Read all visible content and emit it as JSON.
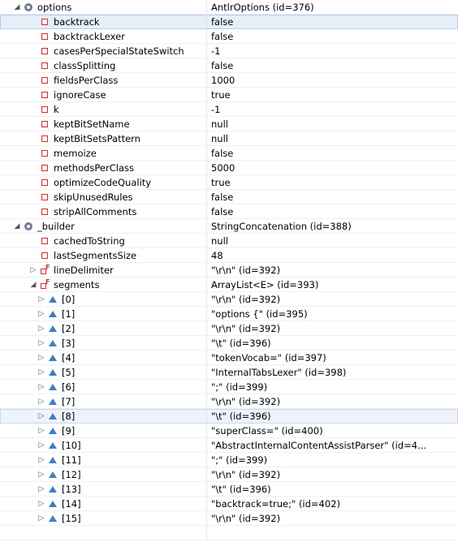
{
  "rows": [
    {
      "depth": 0,
      "exp": "open",
      "icon": "circle",
      "name": "options",
      "value": "AntlrOptions  (id=376)"
    },
    {
      "depth": 1,
      "exp": "none",
      "icon": "square",
      "name": "backtrack",
      "value": "false",
      "sel": 1
    },
    {
      "depth": 1,
      "exp": "none",
      "icon": "square",
      "name": "backtrackLexer",
      "value": "false"
    },
    {
      "depth": 1,
      "exp": "none",
      "icon": "square",
      "name": "casesPerSpecialStateSwitch",
      "value": "-1"
    },
    {
      "depth": 1,
      "exp": "none",
      "icon": "square",
      "name": "classSplitting",
      "value": "false"
    },
    {
      "depth": 1,
      "exp": "none",
      "icon": "square",
      "name": "fieldsPerClass",
      "value": "1000"
    },
    {
      "depth": 1,
      "exp": "none",
      "icon": "square",
      "name": "ignoreCase",
      "value": "true"
    },
    {
      "depth": 1,
      "exp": "none",
      "icon": "square",
      "name": "k",
      "value": "-1"
    },
    {
      "depth": 1,
      "exp": "none",
      "icon": "square",
      "name": "keptBitSetName",
      "value": "null"
    },
    {
      "depth": 1,
      "exp": "none",
      "icon": "square",
      "name": "keptBitSetsPattern",
      "value": "null"
    },
    {
      "depth": 1,
      "exp": "none",
      "icon": "square",
      "name": "memoize",
      "value": "false"
    },
    {
      "depth": 1,
      "exp": "none",
      "icon": "square",
      "name": "methodsPerClass",
      "value": "5000"
    },
    {
      "depth": 1,
      "exp": "none",
      "icon": "square",
      "name": "optimizeCodeQuality",
      "value": "true"
    },
    {
      "depth": 1,
      "exp": "none",
      "icon": "square",
      "name": "skipUnusedRules",
      "value": "false"
    },
    {
      "depth": 1,
      "exp": "none",
      "icon": "square",
      "name": "stripAllComments",
      "value": "false"
    },
    {
      "depth": 0,
      "exp": "open",
      "icon": "circle",
      "name": "_builder",
      "value": "StringConcatenation  (id=388)"
    },
    {
      "depth": 1,
      "exp": "none",
      "icon": "square",
      "name": "cachedToString",
      "value": "null"
    },
    {
      "depth": 1,
      "exp": "none",
      "icon": "square",
      "name": "lastSegmentsSize",
      "value": "48"
    },
    {
      "depth": 1,
      "exp": "closed",
      "icon": "final",
      "name": "lineDelimiter",
      "value": "\"\\r\\n\" (id=392)"
    },
    {
      "depth": 1,
      "exp": "open",
      "icon": "final",
      "name": "segments",
      "value": "ArrayList<E>  (id=393)"
    },
    {
      "depth": 2,
      "exp": "closed",
      "icon": "triangle",
      "name": "[0]",
      "value": "\"\\r\\n\" (id=392)"
    },
    {
      "depth": 2,
      "exp": "closed",
      "icon": "triangle",
      "name": "[1]",
      "value": "\"options {\" (id=395)"
    },
    {
      "depth": 2,
      "exp": "closed",
      "icon": "triangle",
      "name": "[2]",
      "value": "\"\\r\\n\" (id=392)"
    },
    {
      "depth": 2,
      "exp": "closed",
      "icon": "triangle",
      "name": "[3]",
      "value": "\"\\t\" (id=396)"
    },
    {
      "depth": 2,
      "exp": "closed",
      "icon": "triangle",
      "name": "[4]",
      "value": "\"tokenVocab=\" (id=397)"
    },
    {
      "depth": 2,
      "exp": "closed",
      "icon": "triangle",
      "name": "[5]",
      "value": "\"InternalTabsLexer\" (id=398)"
    },
    {
      "depth": 2,
      "exp": "closed",
      "icon": "triangle",
      "name": "[6]",
      "value": "\";\" (id=399)"
    },
    {
      "depth": 2,
      "exp": "closed",
      "icon": "triangle",
      "name": "[7]",
      "value": "\"\\r\\n\" (id=392)"
    },
    {
      "depth": 2,
      "exp": "closed",
      "icon": "triangle",
      "name": "[8]",
      "value": "\"\\t\" (id=396)",
      "sel": 2
    },
    {
      "depth": 2,
      "exp": "closed",
      "icon": "triangle",
      "name": "[9]",
      "value": "\"superClass=\" (id=400)"
    },
    {
      "depth": 2,
      "exp": "closed",
      "icon": "triangle",
      "name": "[10]",
      "value": "\"AbstractInternalContentAssistParser\" (id=4..."
    },
    {
      "depth": 2,
      "exp": "closed",
      "icon": "triangle",
      "name": "[11]",
      "value": "\";\" (id=399)"
    },
    {
      "depth": 2,
      "exp": "closed",
      "icon": "triangle",
      "name": "[12]",
      "value": "\"\\r\\n\" (id=392)"
    },
    {
      "depth": 2,
      "exp": "closed",
      "icon": "triangle",
      "name": "[13]",
      "value": "\"\\t\" (id=396)"
    },
    {
      "depth": 2,
      "exp": "closed",
      "icon": "triangle",
      "name": "[14]",
      "value": "\"backtrack=true;\" (id=402)"
    },
    {
      "depth": 2,
      "exp": "closed",
      "icon": "triangle",
      "name": "[15]",
      "value": "\"\\r\\n\" (id=392)"
    },
    {
      "depth": 0,
      "exp": "none",
      "icon": "none",
      "name": "",
      "value": ""
    }
  ]
}
